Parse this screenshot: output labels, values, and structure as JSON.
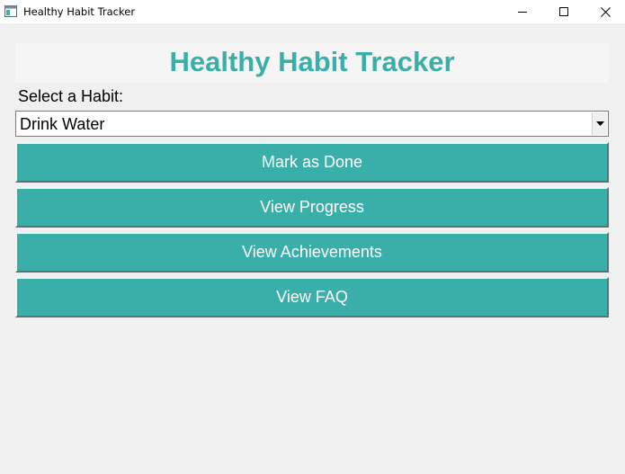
{
  "window": {
    "title": "Healthy Habit Tracker",
    "controls": {
      "minimize": "minimize-icon",
      "maximize": "maximize-icon",
      "close": "close-icon"
    }
  },
  "app": {
    "heading": "Healthy Habit Tracker",
    "select_label": "Select a Habit:",
    "habit_select": {
      "value": "Drink Water",
      "arrow_icon": "dropdown-arrow-icon"
    },
    "buttons": {
      "mark_done": "Mark as Done",
      "view_progress": "View Progress",
      "view_achievements": "View Achievements",
      "view_faq": "View FAQ"
    }
  },
  "colors": {
    "accent": "#3aafa9",
    "background": "#f0f0f0",
    "button_text": "#ffffff"
  }
}
